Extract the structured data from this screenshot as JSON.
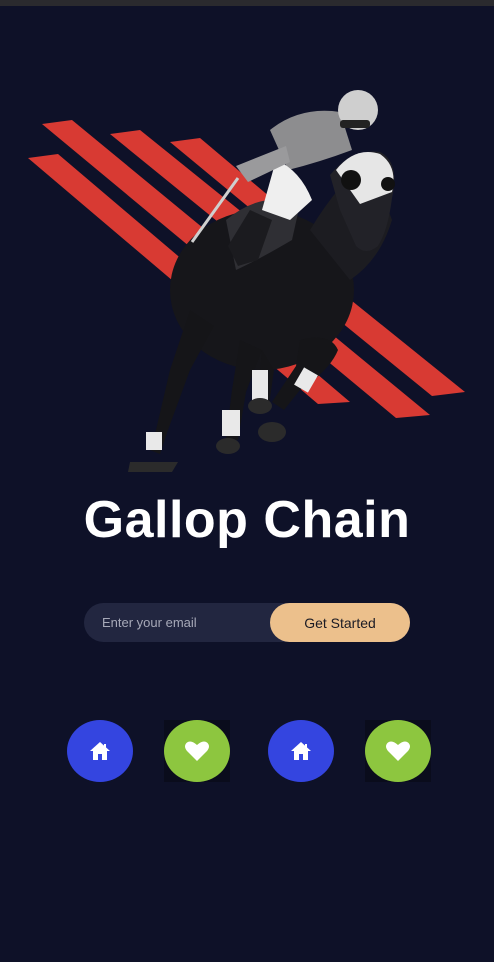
{
  "app": {
    "title": "Gallop Chain"
  },
  "signup": {
    "email_placeholder": "Enter your email",
    "cta_label": "Get Started"
  },
  "nav": {
    "buttons": [
      {
        "icon": "home-icon",
        "color": "#3445e0"
      },
      {
        "icon": "heart-icon",
        "color": "#8dc63f"
      },
      {
        "icon": "home-icon",
        "color": "#3445e0"
      },
      {
        "icon": "heart-icon",
        "color": "#8dc63f"
      }
    ]
  },
  "colors": {
    "background": "#0e1128",
    "stripes": "#d83a33",
    "accent": "#ecc08c",
    "blue": "#3445e0",
    "green": "#8dc63f"
  }
}
